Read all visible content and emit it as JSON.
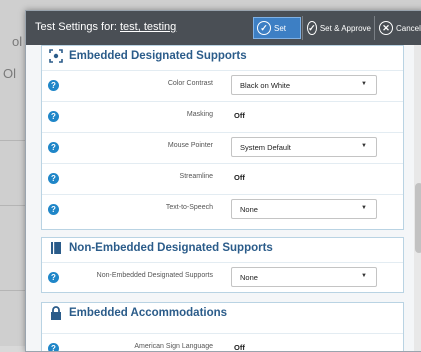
{
  "background": {
    "fragment_1": "ol",
    "fragment_2": "Ol"
  },
  "dialog": {
    "title_prefix": "Test Settings for:",
    "title_link": "test, testing",
    "buttons": {
      "set": "Set",
      "approve": "Set & Approve",
      "cancel": "Cancel"
    }
  },
  "sections": {
    "embedded_supports": {
      "title": "Embedded Designated Supports",
      "rows": [
        {
          "label": "Color Contrast",
          "value": "Black on White",
          "type": "select"
        },
        {
          "label": "Masking",
          "value": "Off",
          "type": "text"
        },
        {
          "label": "Mouse Pointer",
          "value": "System Default",
          "type": "select"
        },
        {
          "label": "Streamline",
          "value": "Off",
          "type": "text"
        },
        {
          "label": "Text-to-Speech",
          "value": "None",
          "type": "select"
        }
      ]
    },
    "non_embedded_supports": {
      "title": "Non-Embedded Designated Supports",
      "rows": [
        {
          "label": "Non-Embedded Designated Supports",
          "value": "None",
          "type": "select"
        }
      ]
    },
    "embedded_accommodations": {
      "title": "Embedded Accommodations",
      "rows": [
        {
          "label": "American Sign Language",
          "value": "Off",
          "type": "text"
        }
      ]
    }
  },
  "colors": {
    "titlebar": "#4a4f55",
    "accent": "#3d7fc4",
    "section_title": "#2b5c8a",
    "help_icon": "#1f86c8"
  }
}
